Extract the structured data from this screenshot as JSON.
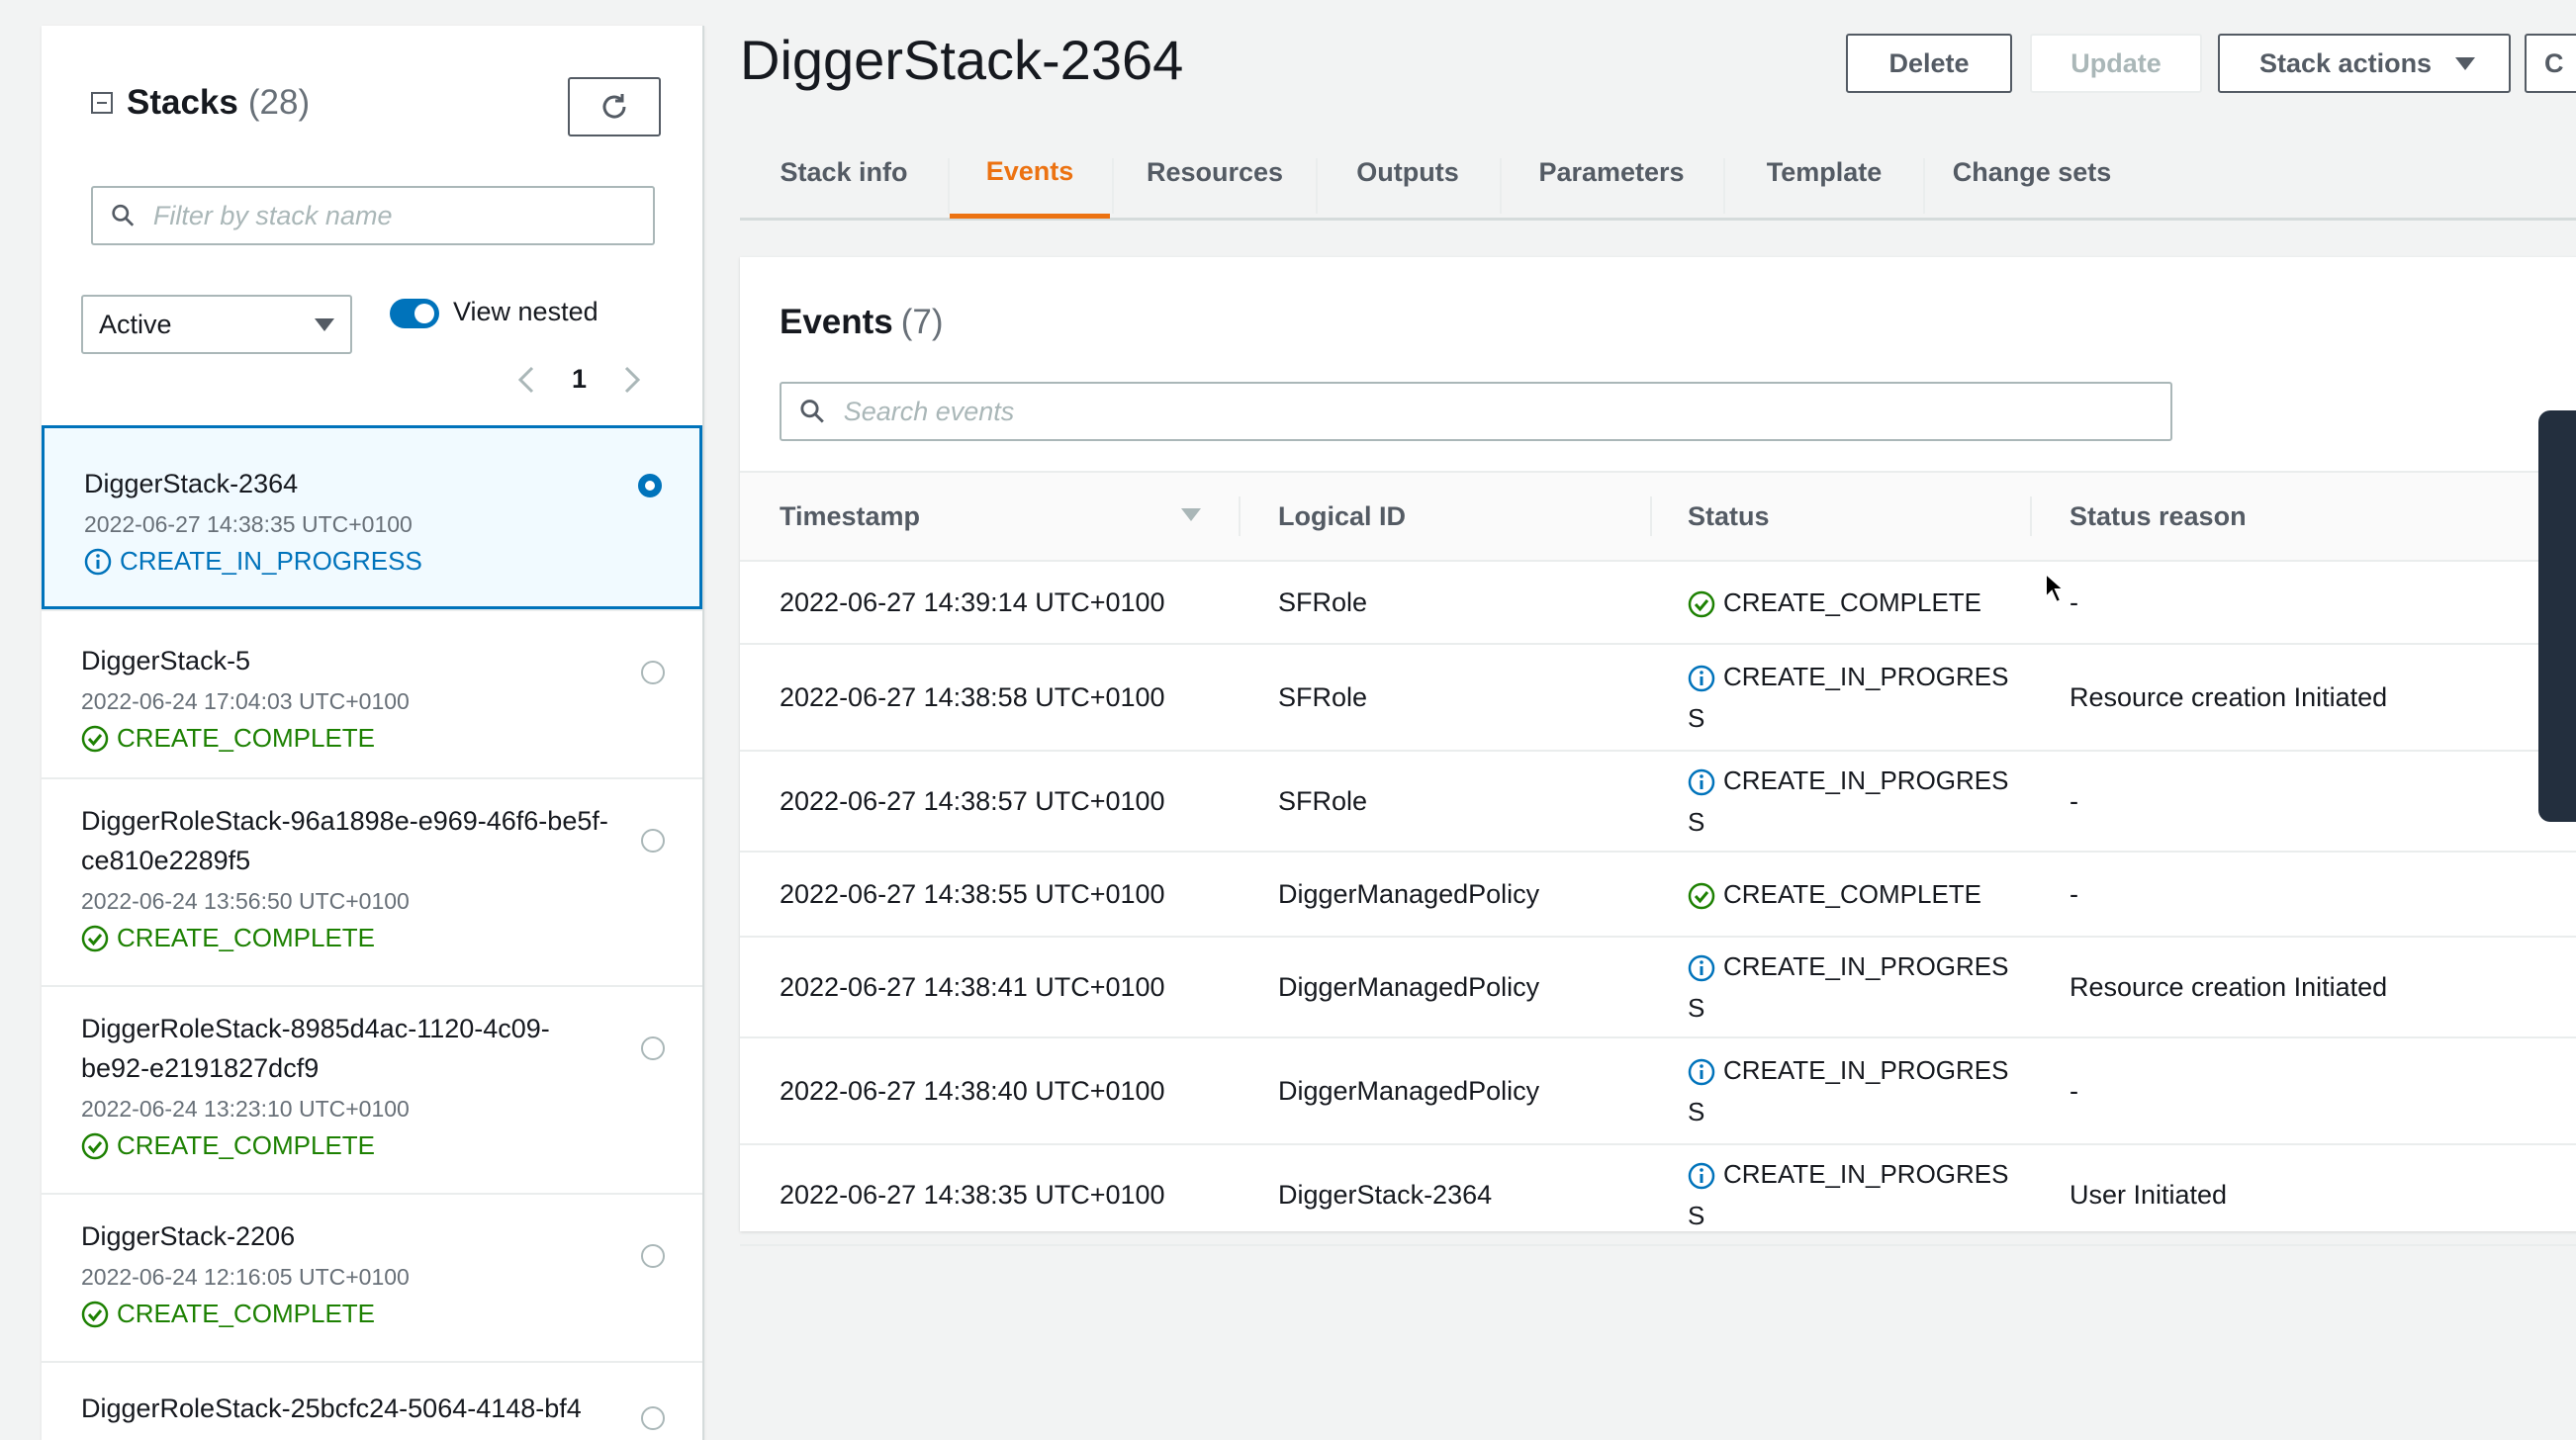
{
  "sidebar": {
    "title": "Stacks",
    "count": "(28)",
    "filter_placeholder": "Filter by stack name",
    "status_filter": "Active",
    "view_nested_label": "View nested",
    "page": "1",
    "stacks": [
      {
        "name": "DiggerStack-2364",
        "time": "2022-06-27 14:38:35 UTC+0100",
        "status": "CREATE_IN_PROGRESS"
      },
      {
        "name": "DiggerStack-5",
        "time": "2022-06-24 17:04:03 UTC+0100",
        "status": "CREATE_COMPLETE"
      },
      {
        "name": "DiggerRoleStack-96a1898e-e969-46f6-be5f-ce810e2289f5",
        "time": "2022-06-24 13:56:50 UTC+0100",
        "status": "CREATE_COMPLETE"
      },
      {
        "name": "DiggerRoleStack-8985d4ac-1120-4c09-be92-e2191827dcf9",
        "time": "2022-06-24 13:23:10 UTC+0100",
        "status": "CREATE_COMPLETE"
      },
      {
        "name": "DiggerStack-2206",
        "time": "2022-06-24 12:16:05 UTC+0100",
        "status": "CREATE_COMPLETE"
      },
      {
        "name": "DiggerRoleStack-25bcfc24-5064-4148-bf4"
      }
    ]
  },
  "main": {
    "stack_title": "DiggerStack-2364",
    "buttons": {
      "delete": "Delete",
      "update": "Update",
      "stack_actions": "Stack actions",
      "create": "C"
    },
    "tabs": [
      "Stack info",
      "Events",
      "Resources",
      "Outputs",
      "Parameters",
      "Template",
      "Change sets"
    ],
    "events": {
      "title": "Events",
      "count": "(7)",
      "search_placeholder": "Search events",
      "columns": [
        "Timestamp",
        "Logical ID",
        "Status",
        "Status reason"
      ],
      "rows": [
        {
          "timestamp": "2022-06-27 14:39:14 UTC+0100",
          "logical_id": "SFRole",
          "status_a": "CREATE_COMPLETE",
          "status_b": "",
          "reason": "-"
        },
        {
          "timestamp": "2022-06-27 14:38:58 UTC+0100",
          "logical_id": "SFRole",
          "status_a": "CREATE_IN_PROGRES",
          "status_b": "S",
          "reason": "Resource creation Initiated"
        },
        {
          "timestamp": "2022-06-27 14:38:57 UTC+0100",
          "logical_id": "SFRole",
          "status_a": "CREATE_IN_PROGRES",
          "status_b": "S",
          "reason": "-"
        },
        {
          "timestamp": "2022-06-27 14:38:55 UTC+0100",
          "logical_id": "DiggerManagedPolicy",
          "status_a": "CREATE_COMPLETE",
          "status_b": "",
          "reason": "-"
        },
        {
          "timestamp": "2022-06-27 14:38:41 UTC+0100",
          "logical_id": "DiggerManagedPolicy",
          "status_a": "CREATE_IN_PROGRES",
          "status_b": "S",
          "reason": "Resource creation Initiated"
        },
        {
          "timestamp": "2022-06-27 14:38:40 UTC+0100",
          "logical_id": "DiggerManagedPolicy",
          "status_a": "CREATE_IN_PROGRES",
          "status_b": "S",
          "reason": "-"
        },
        {
          "timestamp": "2022-06-27 14:38:35 UTC+0100",
          "logical_id": "DiggerStack-2364",
          "status_a": "CREATE_IN_PROGRES",
          "status_b": "S",
          "reason": "User Initiated"
        }
      ]
    }
  },
  "colors": {
    "accent": "#0073bb",
    "tab_active": "#ec7211",
    "success": "#1d8102",
    "info": "#0073bb"
  }
}
